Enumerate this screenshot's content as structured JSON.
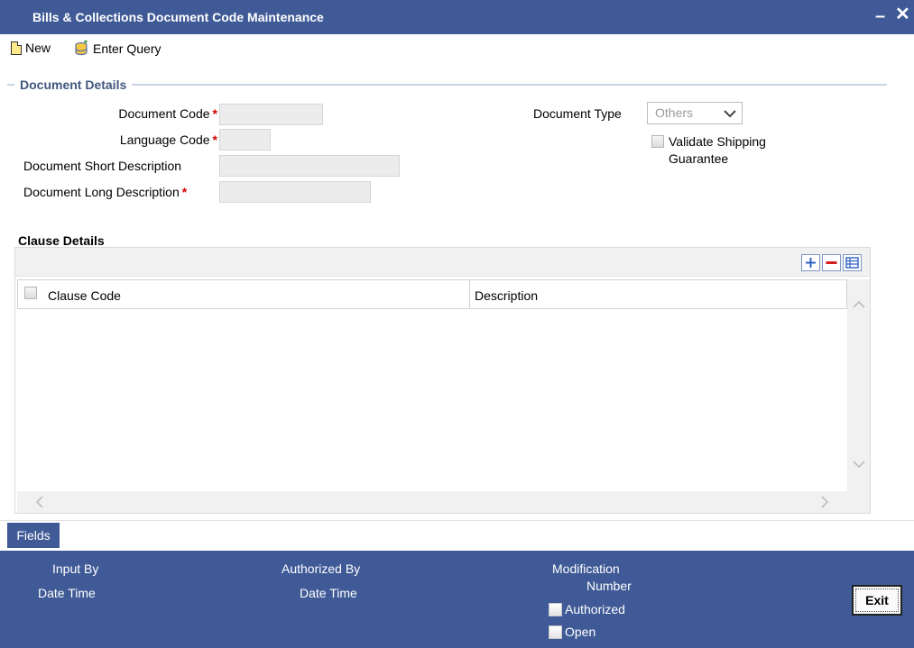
{
  "window": {
    "title": "Bills & Collections Document Code Maintenance",
    "minimize_glyph": "–",
    "close_glyph": "✕"
  },
  "toolbar": {
    "new_label": "New",
    "new_icon": "new-document-icon",
    "query_label": "Enter Query",
    "query_icon": "enter-query-icon"
  },
  "document_details": {
    "section_title": "Document Details",
    "document_code": {
      "label": "Document Code",
      "required": true,
      "value": ""
    },
    "language_code": {
      "label": "Language Code",
      "required": true,
      "value": ""
    },
    "short_description": {
      "label": "Document Short Description",
      "required": false,
      "value": ""
    },
    "long_description": {
      "label": "Document Long Description",
      "required": true,
      "value": ""
    },
    "required_marker": "*",
    "document_type": {
      "label": "Document Type",
      "selected": "Others"
    },
    "validate_shipping": {
      "label_line1": "Validate Shipping",
      "label_line2": "Guarantee",
      "checked": false
    }
  },
  "clause_details": {
    "title": "Clause Details",
    "columns": [
      "Clause Code",
      "Description"
    ],
    "rows": []
  },
  "fields_tab": {
    "label": "Fields"
  },
  "footer": {
    "input_by": "Input By",
    "date_time_1": "Date Time",
    "authorized_by": "Authorized By",
    "date_time_2": "Date Time",
    "modification_line1": "Modification",
    "modification_line2": "Number",
    "authorized_label": "Authorized",
    "authorized_checked": false,
    "open_label": "Open",
    "open_checked": false,
    "exit_label": "Exit"
  },
  "colors": {
    "title_bar": "#3f5a96",
    "section_heading": "#41577f",
    "required": "#d40000",
    "input_background": "#ececec"
  }
}
